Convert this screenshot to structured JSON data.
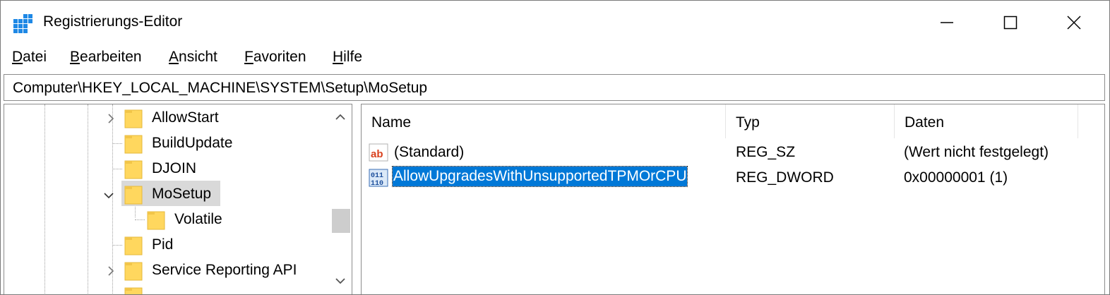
{
  "window": {
    "title": "Registrierungs-Editor",
    "icon": "registry-editor-icon"
  },
  "menu": [
    {
      "underline": "D",
      "rest": "atei"
    },
    {
      "underline": "B",
      "rest": "earbeiten"
    },
    {
      "underline": "A",
      "rest": "nsicht"
    },
    {
      "underline": "F",
      "rest": "avoriten"
    },
    {
      "underline": "H",
      "rest": "ilfe"
    }
  ],
  "address": "Computer\\HKEY_LOCAL_MACHINE\\SYSTEM\\Setup\\MoSetup",
  "tree": {
    "items": [
      {
        "label": "AllowStart",
        "expander": "collapsed"
      },
      {
        "label": "BuildUpdate",
        "expander": "none"
      },
      {
        "label": "DJOIN",
        "expander": "none"
      },
      {
        "label": "MoSetup",
        "expander": "expanded",
        "selected": true
      },
      {
        "label": "Volatile",
        "expander": "none",
        "child": true
      },
      {
        "label": "Pid",
        "expander": "none"
      },
      {
        "label": "Service Reporting API",
        "expander": "collapsed"
      }
    ]
  },
  "list": {
    "columns": [
      "Name",
      "Typ",
      "Daten"
    ],
    "rows": [
      {
        "name": "(Standard)",
        "type": "REG_SZ",
        "data": "(Wert nicht festgelegt)",
        "icon": "string-value-icon"
      },
      {
        "name": "AllowUpgradesWithUnsupportedTPMOrCPU",
        "type": "REG_DWORD",
        "data": "0x00000001 (1)",
        "icon": "dword-value-icon",
        "selected": true
      }
    ]
  },
  "colors": {
    "selection": "#0078d7",
    "folder": "#ffd75e",
    "tree_selection": "#d9d9d9"
  }
}
